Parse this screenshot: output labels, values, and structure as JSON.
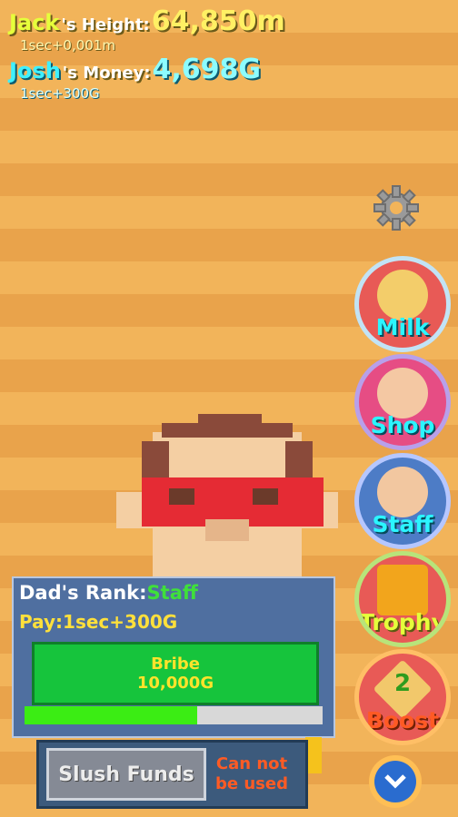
{
  "stats": {
    "height": {
      "name": "Jack",
      "label": "'s Height:",
      "value": "64,850m",
      "rate": "1sec+0,001m"
    },
    "money": {
      "name": "Josh",
      "label": "'s Money:",
      "value": "4,698G",
      "rate": "1sec+300G"
    }
  },
  "menu": [
    {
      "label": "Milk",
      "icon": "milk-bottle-icon"
    },
    {
      "label": "Shop",
      "icon": "shopkeeper-icon"
    },
    {
      "label": "Staff",
      "icon": "staff-person-icon"
    },
    {
      "label": "Trophy",
      "icon": "trophy-icon"
    },
    {
      "label": "Boost",
      "icon": "boost-icon",
      "count": "2"
    }
  ],
  "panel": {
    "rank_label": "Dad's Rank:",
    "rank_value": "Staff",
    "pay": "Pay:1sec+300G",
    "bribe_label": "Bribe",
    "bribe_cost": "10,000G",
    "progress": 0.58
  },
  "slush": {
    "label": "Slush Funds",
    "note_line1": "Can not",
    "note_line2": "be used"
  },
  "colors": {
    "milk": "#e85a56",
    "staff": "#4d7cc6",
    "bribe": "#16c43c",
    "progress": "#3bed14"
  }
}
